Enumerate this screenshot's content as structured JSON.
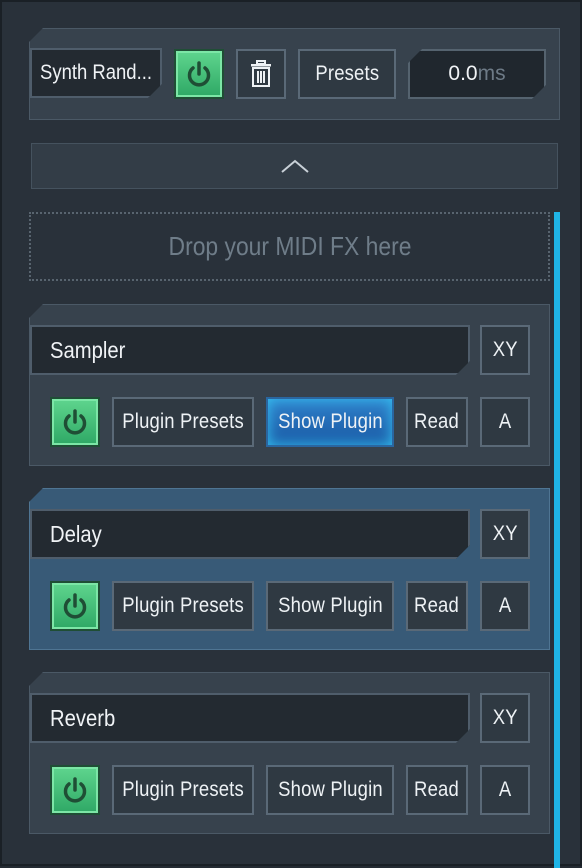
{
  "topbar": {
    "synth_name": "Synth Rand...",
    "presets_label": "Presets",
    "time_value": "0.0",
    "time_unit": "ms"
  },
  "drop_zone": {
    "label": "Drop your MIDI FX here"
  },
  "plugins": [
    {
      "name": "Sampler",
      "xy_label": "XY",
      "presets_label": "Plugin Presets",
      "show_label": "Show Plugin",
      "read_label": "Read",
      "a_label": "A",
      "active": false,
      "show_highlighted": true
    },
    {
      "name": "Delay",
      "xy_label": "XY",
      "presets_label": "Plugin Presets",
      "show_label": "Show Plugin",
      "read_label": "Read",
      "a_label": "A",
      "active": true,
      "show_highlighted": false
    },
    {
      "name": "Reverb",
      "xy_label": "XY",
      "presets_label": "Plugin Presets",
      "show_label": "Show Plugin",
      "read_label": "Read",
      "a_label": "A",
      "active": false,
      "show_highlighted": false
    }
  ],
  "colors": {
    "accent_blue": "#1fb4e6",
    "power_green": "#3fbf76",
    "background": "#242b33"
  },
  "icons": {
    "power": "power-icon",
    "trash": "trash-icon",
    "collapse": "chevron-up-icon"
  }
}
